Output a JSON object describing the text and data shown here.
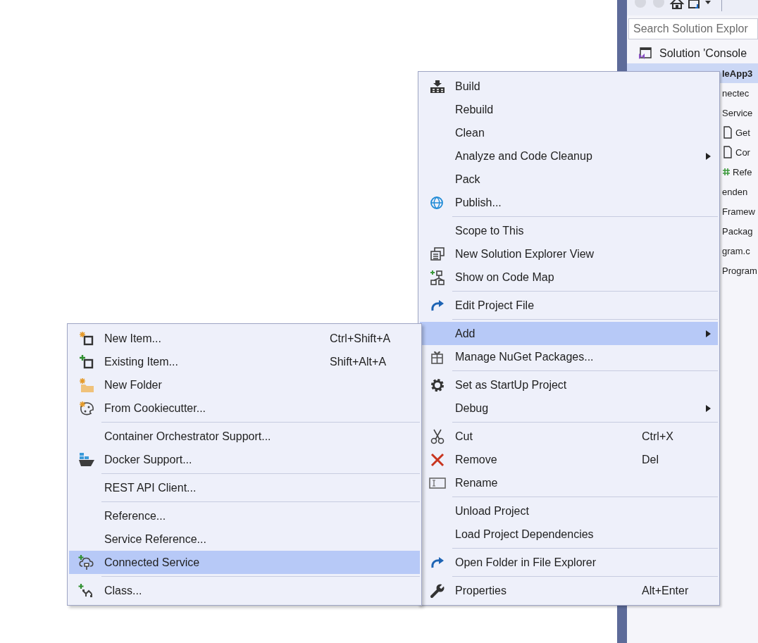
{
  "solution_explorer": {
    "search": {
      "placeholder": "Search Solution Explor"
    },
    "tree": [
      {
        "label": "Solution 'Console",
        "selected": false
      },
      {
        "label": "leApp3",
        "selected": true
      },
      {
        "label": "nectec",
        "selected": false
      },
      {
        "label": "Service",
        "selected": false
      },
      {
        "label": "Get",
        "selected": false
      },
      {
        "label": "Cor",
        "selected": false
      },
      {
        "label": "Refe",
        "selected": false
      },
      {
        "label": "enden",
        "selected": false
      },
      {
        "label": "Framew",
        "selected": false
      },
      {
        "label": "Packag",
        "selected": false
      },
      {
        "label": "gram.c",
        "selected": false
      },
      {
        "label": "Program",
        "selected": false
      }
    ]
  },
  "context_menu": {
    "items": [
      {
        "kind": "item",
        "label": "Build",
        "selected": false,
        "submenu": false
      },
      {
        "kind": "item",
        "label": "Rebuild",
        "selected": false,
        "submenu": false
      },
      {
        "kind": "item",
        "label": "Clean",
        "selected": false,
        "submenu": false
      },
      {
        "kind": "item",
        "label": "Analyze and Code Cleanup",
        "selected": false,
        "submenu": true
      },
      {
        "kind": "item",
        "label": "Pack",
        "selected": false,
        "submenu": false
      },
      {
        "kind": "item",
        "label": "Publish...",
        "selected": false,
        "submenu": false
      },
      {
        "kind": "separator"
      },
      {
        "kind": "item",
        "label": "Scope to This",
        "selected": false,
        "submenu": false
      },
      {
        "kind": "item",
        "label": "New Solution Explorer View",
        "selected": false,
        "submenu": false
      },
      {
        "kind": "item",
        "label": "Show on Code Map",
        "selected": false,
        "submenu": false
      },
      {
        "kind": "separator"
      },
      {
        "kind": "item",
        "label": "Edit Project File",
        "selected": false,
        "submenu": false
      },
      {
        "kind": "separator"
      },
      {
        "kind": "item",
        "label": "Add",
        "selected": true,
        "submenu": true
      },
      {
        "kind": "item",
        "label": "Manage NuGet Packages...",
        "selected": false,
        "submenu": false
      },
      {
        "kind": "separator"
      },
      {
        "kind": "item",
        "label": "Set as StartUp Project",
        "selected": false,
        "submenu": false
      },
      {
        "kind": "item",
        "label": "Debug",
        "selected": false,
        "submenu": true
      },
      {
        "kind": "separator"
      },
      {
        "kind": "item",
        "label": "Cut",
        "shortcut": "Ctrl+X",
        "selected": false,
        "submenu": false
      },
      {
        "kind": "item",
        "label": "Remove",
        "shortcut": "Del",
        "selected": false,
        "submenu": false
      },
      {
        "kind": "item",
        "label": "Rename",
        "selected": false,
        "submenu": false
      },
      {
        "kind": "separator"
      },
      {
        "kind": "item",
        "label": "Unload Project",
        "selected": false,
        "submenu": false
      },
      {
        "kind": "item",
        "label": "Load Project Dependencies",
        "selected": false,
        "submenu": false
      },
      {
        "kind": "separator"
      },
      {
        "kind": "item",
        "label": "Open Folder in File Explorer",
        "selected": false,
        "submenu": false
      },
      {
        "kind": "separator"
      },
      {
        "kind": "item",
        "label": "Properties",
        "shortcut": "Alt+Enter",
        "selected": false,
        "submenu": false
      }
    ]
  },
  "add_submenu": {
    "items": [
      {
        "kind": "item",
        "label": "New Item...",
        "shortcut": "Ctrl+Shift+A",
        "selected": false
      },
      {
        "kind": "item",
        "label": "Existing Item...",
        "shortcut": "Shift+Alt+A",
        "selected": false
      },
      {
        "kind": "item",
        "label": "New Folder",
        "selected": false
      },
      {
        "kind": "item",
        "label": "From Cookiecutter...",
        "selected": false
      },
      {
        "kind": "separator"
      },
      {
        "kind": "item",
        "label": "Container Orchestrator Support...",
        "selected": false
      },
      {
        "kind": "item",
        "label": "Docker Support...",
        "selected": false
      },
      {
        "kind": "separator"
      },
      {
        "kind": "item",
        "label": "REST API Client...",
        "selected": false
      },
      {
        "kind": "separator"
      },
      {
        "kind": "item",
        "label": "Reference...",
        "selected": false
      },
      {
        "kind": "item",
        "label": "Service Reference...",
        "selected": false
      },
      {
        "kind": "item",
        "label": "Connected Service",
        "selected": true
      },
      {
        "kind": "separator"
      },
      {
        "kind": "item",
        "label": "Class...",
        "selected": false
      }
    ]
  }
}
